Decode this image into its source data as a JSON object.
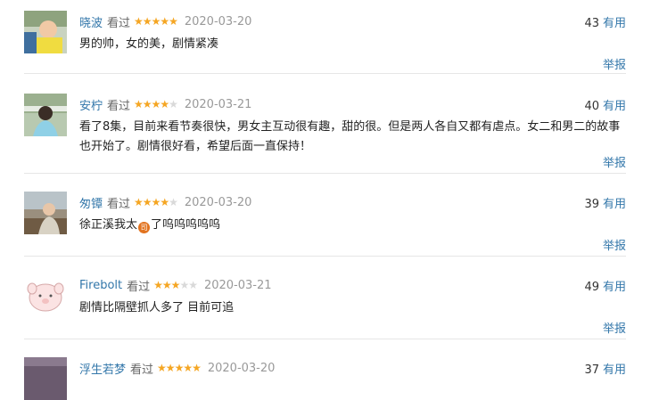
{
  "reviews": [
    {
      "user": "晓波",
      "status": "看过",
      "rating": 5,
      "date": "2020-03-20",
      "useful_count": "43",
      "useful_label": "有用",
      "content": "男的帅，女的美，剧情紧凑",
      "report": "举报"
    },
    {
      "user": "安柠",
      "status": "看过",
      "rating": 4,
      "date": "2020-03-21",
      "useful_count": "40",
      "useful_label": "有用",
      "content": "看了8集，目前来看节奏很快，男女主互动很有趣，甜的很。但是两人各自又都有虐点。女二和男二的故事也开始了。剧情很好看，希望后面一直保持！",
      "report": "举报"
    },
    {
      "user": "匆镡",
      "status": "看过",
      "rating": 4,
      "date": "2020-03-20",
      "useful_count": "39",
      "useful_label": "有用",
      "content_before": "徐正溪我太",
      "content_emoji": "司",
      "content_after": "了呜呜呜呜呜",
      "report": "举报"
    },
    {
      "user": "Firebolt",
      "status": "看过",
      "rating": 3,
      "date": "2020-03-21",
      "useful_count": "49",
      "useful_label": "有用",
      "content": "剧情比隔壁抓人多了 目前可追",
      "report": "举报"
    },
    {
      "user": "浮生若梦",
      "status": "看过",
      "rating": 5,
      "date": "2020-03-20",
      "useful_count": "37",
      "useful_label": "有用"
    }
  ],
  "colors": {
    "link": "#3377aa",
    "star_on": "#f5a623",
    "star_off": "#d9d9d9",
    "date": "#999999"
  }
}
